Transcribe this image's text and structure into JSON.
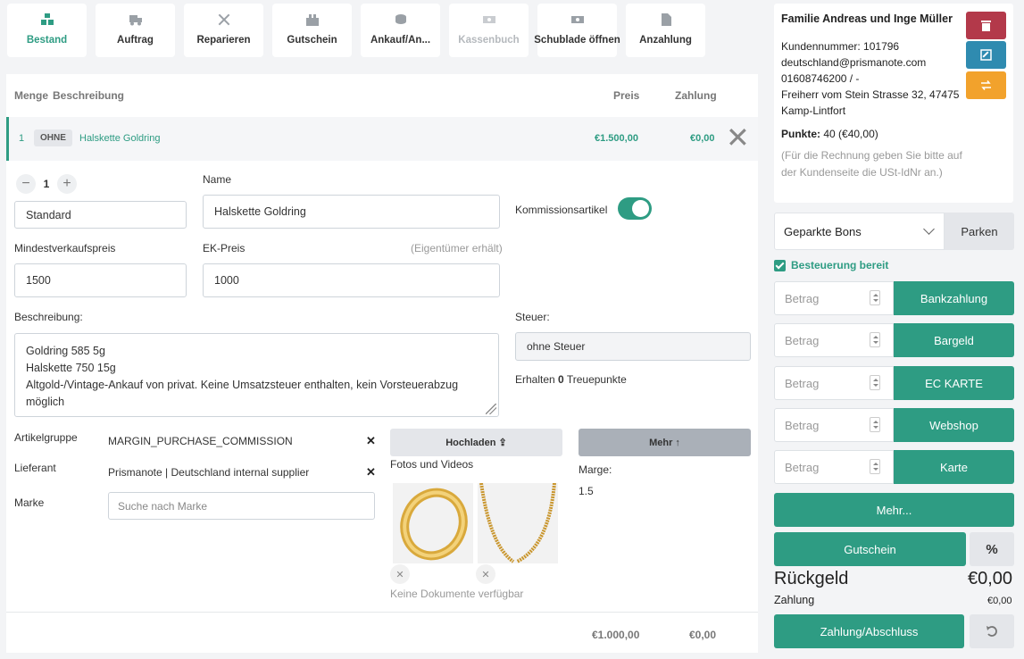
{
  "toolbar": {
    "items": [
      {
        "label": "Bestand",
        "icon": "boxes-icon",
        "state": "active"
      },
      {
        "label": "Auftrag",
        "icon": "truck-icon",
        "state": "normal"
      },
      {
        "label": "Reparieren",
        "icon": "tools-icon",
        "state": "normal"
      },
      {
        "label": "Gutschein",
        "icon": "gift-card-icon",
        "state": "normal"
      },
      {
        "label": "Ankauf/An...",
        "icon": "coins-icon",
        "state": "normal"
      },
      {
        "label": "Kassenbuch",
        "icon": "cash-icon",
        "state": "disabled"
      },
      {
        "label": "Schublade öffnen",
        "icon": "cash-drawer-icon",
        "state": "normal"
      },
      {
        "label": "Anzahlung",
        "icon": "invoice-dollar-icon",
        "state": "normal"
      }
    ]
  },
  "table": {
    "headers": {
      "menge": "Menge",
      "beschreibung": "Beschreibung",
      "preis": "Preis",
      "zahlung": "Zahlung"
    },
    "row": {
      "qty": "1",
      "badge": "OHNE",
      "name": "Halskette Goldring",
      "price": "€1.500,00",
      "payment": "€0,00"
    },
    "footer": {
      "total": "€1.000,00",
      "payment": "€0,00"
    }
  },
  "detail": {
    "quantity": "1",
    "variant_value": "Standard",
    "name_label": "Name",
    "name_value": "Halskette Goldring",
    "commission_label": "Kommissionsartikel",
    "commission_on": true,
    "min_price_label": "Mindestverkaufspreis",
    "min_price_value": "1500",
    "ek_label": "EK-Preis",
    "ek_hint": "(Eigentümer erhält)",
    "ek_value": "1000",
    "description_label": "Beschreibung:",
    "description_lines": [
      "Goldring 585 5g",
      "Halskette 750 15g",
      "Altgold-/Vintage-Ankauf von privat. Keine Umsatzsteuer enthalten, kein Vorsteuerabzug",
      "möglich"
    ],
    "tax_label": "Steuer:",
    "tax_value": "ohne Steuer",
    "points_prefix": "Erhalten",
    "points_value": "0",
    "points_suffix": "Treuepunkte",
    "group_label": "Artikelgruppe",
    "group_value": "MARGIN_PURCHASE_COMMISSION",
    "supplier_label": "Lieferant",
    "supplier_value": "Prismanote | Deutschland internal supplier",
    "brand_label": "Marke",
    "brand_placeholder": "Suche nach Marke",
    "upload_label": "Hochladen",
    "more_label": "Mehr",
    "media_label": "Fotos und Videos",
    "no_docs": "Keine Dokumente verfügbar",
    "margin_label": "Marge:",
    "margin_value": "1.5"
  },
  "customer": {
    "name": "Familie Andreas und Inge Müller",
    "number": "Kundennummer: 101796",
    "email": "deutschland@prismanote.com",
    "phone": "01608746200 / -",
    "address1": "Freiherr vom Stein Strasse 32, 47475",
    "address2": "Kamp-Lintfort",
    "points_label": "Punkte:",
    "points_value": "40 (€40,00)",
    "vat_note": "(Für die Rechnung geben Sie bitte auf der Kundenseite die USt-IdNr an.)"
  },
  "parked": {
    "select_value": "Geparkte Bons",
    "park_label": "Parken"
  },
  "tax_ready": "Besteuerung bereit",
  "payments": [
    {
      "placeholder": "Betrag",
      "label": "Bankzahlung"
    },
    {
      "placeholder": "Betrag",
      "label": "Bargeld"
    },
    {
      "placeholder": "Betrag",
      "label": "EC KARTE"
    },
    {
      "placeholder": "Betrag",
      "label": "Webshop"
    },
    {
      "placeholder": "Betrag",
      "label": "Karte"
    }
  ],
  "more_payments": "Mehr...",
  "voucher_label": "Gutschein",
  "percent_label": "%",
  "change": {
    "label": "Rückgeld",
    "value": "€0,00"
  },
  "paid": {
    "label": "Zahlung",
    "value": "€0,00"
  },
  "checkout_label": "Zahlung/Abschluss",
  "colors": {
    "accent": "#2e9c83",
    "danger": "#b3394a",
    "info": "#2f8bb0",
    "warning": "#f2a22c"
  }
}
